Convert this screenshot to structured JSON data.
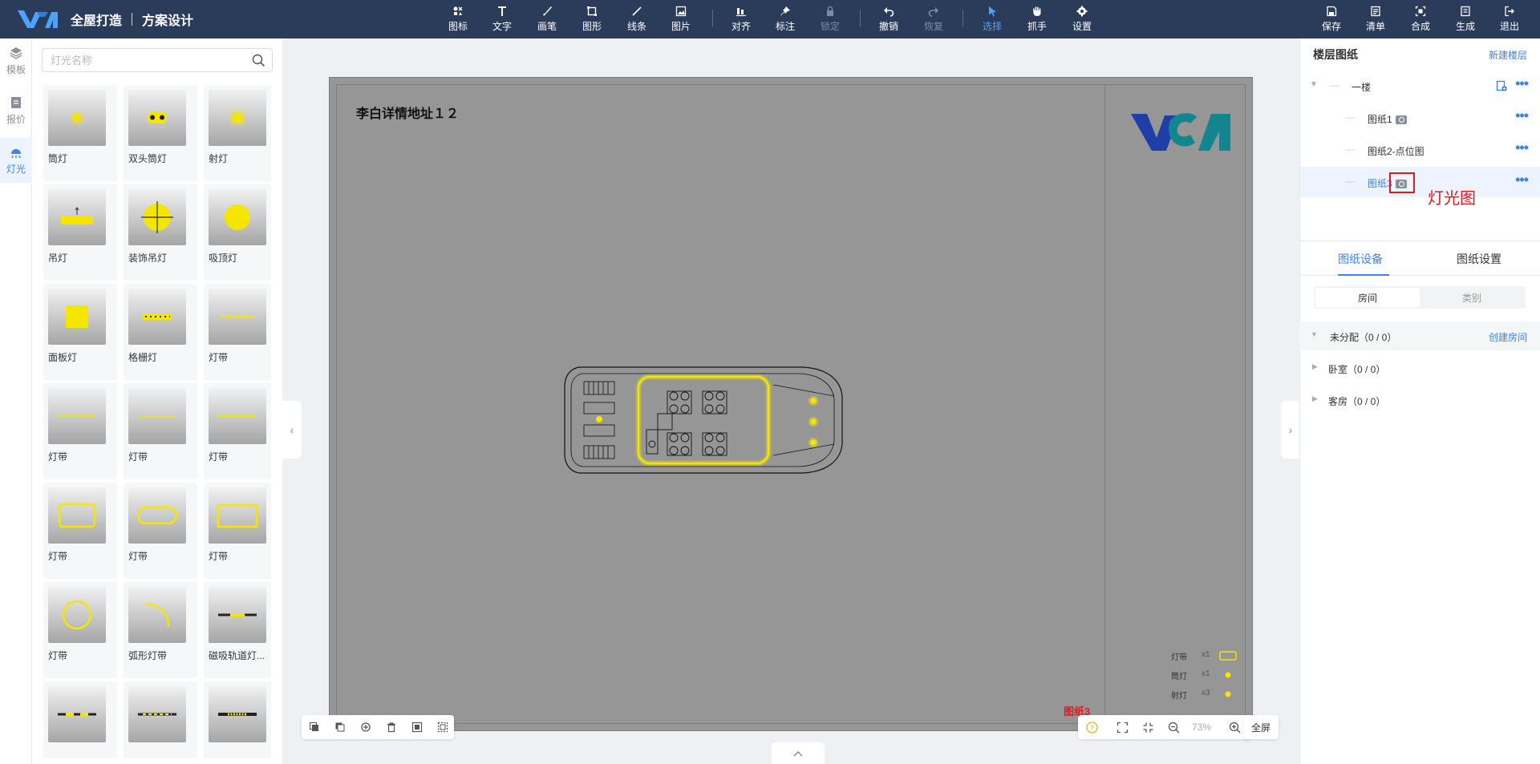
{
  "topbar": {
    "app_title": "全屋打造",
    "subtitle": "方案设计",
    "tools": [
      {
        "label": "图标",
        "icon": "icons-icon"
      },
      {
        "label": "文字",
        "icon": "text-icon"
      },
      {
        "label": "画笔",
        "icon": "brush-icon"
      },
      {
        "label": "图形",
        "icon": "shape-icon"
      },
      {
        "label": "线条",
        "icon": "line-icon"
      },
      {
        "label": "图片",
        "icon": "image-icon"
      },
      {
        "label": "对齐",
        "icon": "align-icon"
      },
      {
        "label": "标注",
        "icon": "pin-icon"
      },
      {
        "label": "锁定",
        "icon": "lock-icon"
      },
      {
        "label": "撤销",
        "icon": "undo-icon"
      },
      {
        "label": "恢复",
        "icon": "redo-icon"
      },
      {
        "label": "选择",
        "icon": "cursor-icon"
      },
      {
        "label": "抓手",
        "icon": "hand-icon"
      },
      {
        "label": "设置",
        "icon": "gear-icon"
      }
    ],
    "actions": [
      {
        "label": "保存",
        "icon": "save-icon"
      },
      {
        "label": "清单",
        "icon": "list-icon"
      },
      {
        "label": "合成",
        "icon": "compose-icon"
      },
      {
        "label": "生成",
        "icon": "generate-icon"
      },
      {
        "label": "退出",
        "icon": "exit-icon"
      }
    ]
  },
  "left_rail": [
    {
      "label": "模板",
      "icon": "layers-icon"
    },
    {
      "label": "报价",
      "icon": "quote-icon"
    },
    {
      "label": "灯光",
      "icon": "light-icon"
    }
  ],
  "library": {
    "search_placeholder": "灯光名称",
    "items": [
      {
        "label": "筒灯",
        "icon": "downlight-icon"
      },
      {
        "label": "双头筒灯",
        "icon": "double-downlight-icon"
      },
      {
        "label": "射灯",
        "icon": "spotlight-icon"
      },
      {
        "label": "吊灯",
        "icon": "pendant-icon"
      },
      {
        "label": "装饰吊灯",
        "icon": "decor-pendant-icon"
      },
      {
        "label": "吸顶灯",
        "icon": "ceiling-light-icon"
      },
      {
        "label": "面板灯",
        "icon": "panel-light-icon"
      },
      {
        "label": "格栅灯",
        "icon": "grille-light-icon"
      },
      {
        "label": "灯带",
        "icon": "strip-icon"
      },
      {
        "label": "灯带",
        "icon": "strip-icon"
      },
      {
        "label": "灯带",
        "icon": "strip-icon"
      },
      {
        "label": "灯带",
        "icon": "strip-icon"
      },
      {
        "label": "灯带",
        "icon": "rect-strip-icon"
      },
      {
        "label": "灯带",
        "icon": "rounded-strip-icon"
      },
      {
        "label": "灯带",
        "icon": "rect-strip-icon"
      },
      {
        "label": "灯带",
        "icon": "circle-strip-icon"
      },
      {
        "label": "弧形灯带",
        "icon": "arc-strip-icon"
      },
      {
        "label": "磁吸轨道灯...",
        "icon": "track-light-icon"
      },
      {
        "label": "",
        "icon": "track-light-icon"
      },
      {
        "label": "",
        "icon": "track-light-icon"
      },
      {
        "label": "",
        "icon": "track-light-icon"
      }
    ]
  },
  "canvas": {
    "address": "李白详情地址１２",
    "sheet_name": "图纸3",
    "legend": [
      {
        "name": "灯带",
        "count": "x1",
        "symbol": "strip"
      },
      {
        "name": "筒灯",
        "count": "x1",
        "symbol": "dot"
      },
      {
        "name": "射灯",
        "count": "x3",
        "symbol": "dot"
      }
    ],
    "zoom": "73%",
    "fullscreen_label": "全屏"
  },
  "right_panel": {
    "title": "楼层图纸",
    "new_floor": "新建楼层",
    "floor": "一楼",
    "sheets": [
      "图纸1",
      "图纸2-点位图",
      "图纸3"
    ],
    "selected_sheet": "图纸3",
    "annotation": "灯光图",
    "tabs": [
      "图纸设备",
      "图纸设置"
    ],
    "segments": [
      "房间",
      "类别"
    ],
    "rooms": [
      {
        "name": "未分配（0 / 0）",
        "action": "创建房间"
      },
      {
        "name": "卧室（0 / 0）",
        "action": ""
      },
      {
        "name": "客房（0 / 0）",
        "action": ""
      }
    ]
  },
  "colors": {
    "topbar_bg": "#2b3c5a",
    "accent": "#3b82f6",
    "annotation_red": "#e0191f",
    "light_yellow": "#f5e600",
    "logo_blue": "#1e3ea8",
    "logo_teal": "#12858f"
  }
}
